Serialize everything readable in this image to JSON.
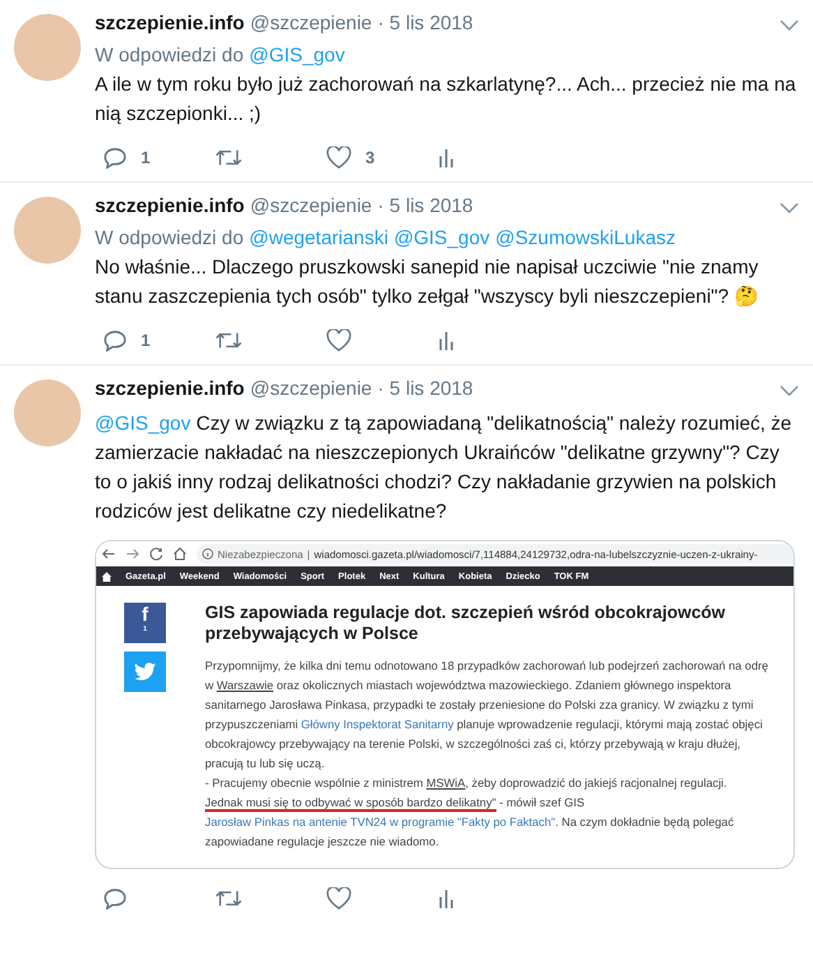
{
  "tweets": [
    {
      "name": "szczepienie.info",
      "handle": "@szczepienie",
      "date": "· 5 lis 2018",
      "reply_to": {
        "label": "W odpowiedzi do",
        "mentions": [
          "@GIS_gov"
        ]
      },
      "text": [
        {
          "kind": "text",
          "text": "A ile w tym roku było już zachorowań na szkarlatynę?... Ach... przecież nie ma na nią szczepionki... ;)"
        }
      ],
      "replies": "1",
      "likes": "3"
    },
    {
      "name": "szczepienie.info",
      "handle": "@szczepienie",
      "date": "· 5 lis 2018",
      "reply_to": {
        "label": "W odpowiedzi do",
        "mentions": [
          "@wegetarianski",
          "@GIS_gov",
          "@SzumowskiLukasz"
        ]
      },
      "text": [
        {
          "kind": "text",
          "text": "No właśnie... Dlaczego pruszkowski sanepid nie napisał uczciwie \"nie znamy stanu zaszczepienia tych osób\" tylko zełgał \"wszyscy byli nieszczepieni\"? 🤔"
        }
      ],
      "replies": "1"
    },
    {
      "name": "szczepienie.info",
      "handle": "@szczepienie",
      "date": "· 5 lis 2018",
      "text": [
        {
          "kind": "mention",
          "text": "@GIS_gov"
        },
        {
          "kind": "text",
          "text": " Czy w związku z tą zapowiadaną \"delikatnością\" należy rozumieć, że zamierzacie nakładać na nieszczepionych Ukraińców \"delikatne grzywny\"? Czy to o jakiś inny rodzaj delikatności chodzi? Czy nakładanie grzywien na polskich rodziców jest delikatne czy niedelikatne?"
        }
      ],
      "screenshot": {
        "security": "Niezabezpieczona",
        "separator": "|",
        "url": "wiadomosci.gazeta.pl/wiadomosci/7,114884,24129732,odra-na-lubelszczyznie-uczen-z-ukrainy-",
        "nav": [
          "Gazeta.pl",
          "Weekend",
          "Wiadomości",
          "Sport",
          "Plotek",
          "Next",
          "Kultura",
          "Kobieta",
          "Dziecko",
          "TOK FM"
        ],
        "facebook": {
          "letter": "f",
          "count": "1"
        },
        "title": "GIS zapowiada regulacje dot. szczepień wśród obcokrajowców przebywających w Polsce",
        "paragraphs": [
          [
            {
              "kind": "text",
              "text": "Przypomnijmy, że kilka dni temu odnotowano 18 przypadków zachorowań lub podejrzeń zachorowań na odrę w "
            },
            {
              "kind": "underlined",
              "text": "Warszawie"
            },
            {
              "kind": "text",
              "text": " oraz okolicznych miastach województwa mazowieckiego. Zdaniem głównego inspektora sanitarnego Jarosława Pinkasa, przypadki te zostały przeniesione do Polski zza granicy. W związku z tymi przypuszczeniami "
            },
            {
              "kind": "link",
              "text": "Główny Inspektorat Sanitarny"
            },
            {
              "kind": "text",
              "text": " planuje wprowadzenie regulacji, którymi mają zostać objęci obcokrajowcy przebywający na terenie Polski, w szczególności zaś ci, którzy przebywają w kraju dłużej, pracują tu lub się uczą."
            }
          ],
          [
            {
              "kind": "text",
              "text": "- Pracujemy obecnie wspólnie z ministrem "
            },
            {
              "kind": "underlined",
              "text": "MSWiA"
            },
            {
              "kind": "text",
              "text": ", żeby doprowadzić do jakiejś racjonalnej regulacji. "
            },
            {
              "kind": "highlight",
              "text": "Jednak musi się to odbywać w sposób bardzo delikatny\""
            },
            {
              "kind": "text",
              "text": " - mówił szef GIS "
            },
            {
              "kind": "link",
              "text": "Jarosław Pinkas na antenie TVN24 w programie \"Fakty po Faktach\""
            },
            {
              "kind": "text",
              "text": ". Na czym dokładnie będą polegać zapowiadane regulacje jeszcze nie wiadomo."
            }
          ]
        ]
      }
    }
  ]
}
